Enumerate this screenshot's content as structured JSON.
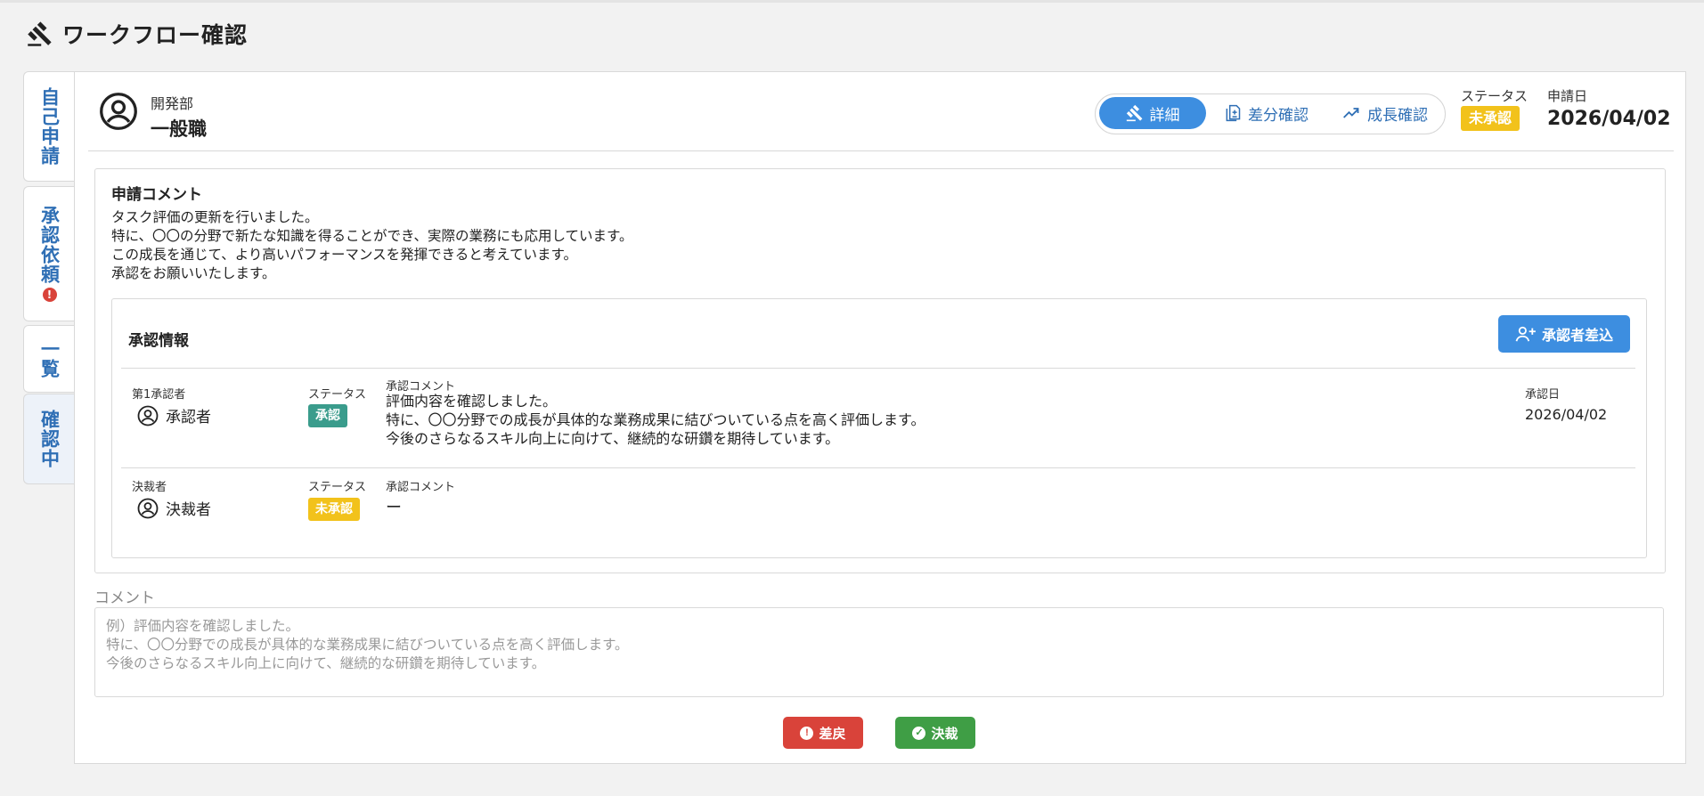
{
  "page": {
    "title": "ワークフロー確認",
    "icon": "gavel-icon"
  },
  "tabs": [
    {
      "label": "自己申請",
      "icon": null
    },
    {
      "label": "承認依頼",
      "icon": "alert-icon"
    },
    {
      "label": "一覧",
      "icon": null
    },
    {
      "label": "確認中",
      "icon": null
    }
  ],
  "applicant": {
    "department": "開発部",
    "role": "一般職"
  },
  "view_toggle": {
    "options": [
      {
        "label": "詳細",
        "icon": "gavel-icon"
      },
      {
        "label": "差分確認",
        "icon": "document-diff-icon"
      },
      {
        "label": "成長確認",
        "icon": "trending-up-icon"
      }
    ]
  },
  "status": {
    "label": "ステータス",
    "value": "未承認"
  },
  "application_date": {
    "label": "申請日",
    "value": "2026/04/02"
  },
  "application_comment": {
    "title": "申請コメント",
    "lines": [
      "タスク評価の更新を行いました。",
      "特に、〇〇の分野で新たな知識を得ることができ、実際の業務にも応用しています。",
      "この成長を通じて、より高いパフォーマンスを発揮できると考えています。",
      "承認をお願いいたします。"
    ]
  },
  "approval_info": {
    "title": "承認情報",
    "add_button": "承認者差込",
    "rows": [
      {
        "role_label": "第1承認者",
        "person": "承認者",
        "status_label": "ステータス",
        "status": "承認",
        "comment_label": "承認コメント",
        "comment_lines": [
          "評価内容を確認しました。",
          "特に、〇〇分野での成長が具体的な業務成果に結びついている点を高く評価します。",
          "今後のさらなるスキル向上に向けて、継続的な研鑽を期待しています。"
        ],
        "date_label": "承認日",
        "date": "2026/04/02"
      },
      {
        "role_label": "決裁者",
        "person": "決裁者",
        "status_label": "ステータス",
        "status": "未承認",
        "comment_label": "承認コメント",
        "comment_lines": [
          "ー"
        ]
      }
    ]
  },
  "comment_field": {
    "label": "コメント",
    "placeholder_lines": [
      "例）評価内容を確認しました。",
      "特に、〇〇分野での成長が具体的な業務成果に結びついている点を高く評価します。",
      "今後のさらなるスキル向上に向けて、継続的な研鑽を期待しています。"
    ]
  },
  "actions": {
    "reject": "差戻",
    "approve": "決裁"
  },
  "colors": {
    "primary": "#3d8ee0",
    "link": "#2f6fb5",
    "pending": "#f2c21b",
    "approved": "#3a9c8c",
    "reject": "#d9433a",
    "approve": "#3f9e45"
  }
}
